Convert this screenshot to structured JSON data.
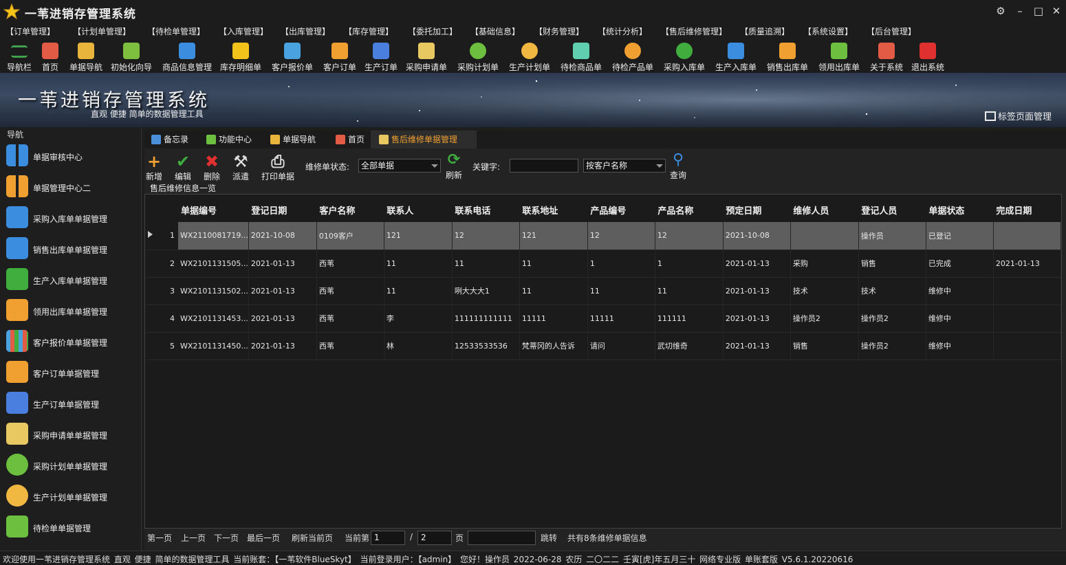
{
  "app": {
    "title": "一苇进销存管理系统"
  },
  "menu": [
    "【订单管理】",
    "【计划单管理】",
    "【待检单管理】",
    "【入库管理】",
    "【出库管理】",
    "【库存管理】",
    "【委托加工】",
    "【基础信息】",
    "【财务管理】",
    "【统计分析】",
    "【售后维修管理】",
    "【质量追溯】",
    "【系统设置】",
    "【后台管理】"
  ],
  "toolbar": [
    {
      "label": "导航栏",
      "icon": "menu-icon",
      "color": "#3fa34d"
    },
    {
      "label": "首页",
      "icon": "home-icon",
      "color": "#e25b45"
    },
    {
      "label": "单据导航",
      "icon": "pen-icon",
      "color": "#e8b43b"
    },
    {
      "label": "初始化向导",
      "icon": "wand-icon",
      "color": "#7fbf3f"
    },
    {
      "label": "商品信息管理",
      "icon": "cubes-icon",
      "color": "#3b8de0"
    },
    {
      "label": "库存明细单",
      "icon": "warning-icon",
      "color": "#f2c21a"
    },
    {
      "label": "客户报价单",
      "icon": "tag-icon",
      "color": "#4aa3df"
    },
    {
      "label": "客户订单",
      "icon": "doc-icon",
      "color": "#f0a030"
    },
    {
      "label": "生产订单",
      "icon": "doc-blue-icon",
      "color": "#4a7fe0"
    },
    {
      "label": "采购申请单",
      "icon": "request-icon",
      "color": "#e8c860"
    },
    {
      "label": "采购计划单",
      "icon": "chat-green-icon",
      "color": "#6cbf3f"
    },
    {
      "label": "生产计划单",
      "icon": "chat-yellow-icon",
      "color": "#f0b840"
    },
    {
      "label": "待检商品单",
      "icon": "flask-icon",
      "color": "#5fcfb0"
    },
    {
      "label": "待检产品单",
      "icon": "beaker-icon",
      "color": "#f0a030"
    },
    {
      "label": "采购入库单",
      "icon": "plus-circle-icon",
      "color": "#3fae3f"
    },
    {
      "label": "生产入库单",
      "icon": "trolley-icon",
      "color": "#3b8de0"
    },
    {
      "label": "销售出库单",
      "icon": "export-icon",
      "color": "#f0a030"
    },
    {
      "label": "领用出库单",
      "icon": "download-icon",
      "color": "#6cbf3f"
    },
    {
      "label": "关于系统",
      "icon": "house-icon",
      "color": "#e25b45"
    },
    {
      "label": "退出系统",
      "icon": "exit-icon",
      "color": "#e03030"
    }
  ],
  "banner": {
    "title": "一苇进销存管理系统",
    "subtitle": "直观 便捷 简单的数据管理工具",
    "tab_manager": "标签页面管理"
  },
  "sidebar": {
    "title": "导航",
    "items": [
      {
        "label": "单据审核中心",
        "icon": "grid-icon",
        "color": "#3b8de0"
      },
      {
        "label": "单据管理中心二",
        "icon": "grid-orange-icon",
        "color": "#f0a030"
      },
      {
        "label": "采购入库单单据管理",
        "icon": "arrow-left-icon",
        "color": "#3b8de0"
      },
      {
        "label": "销售出库单单据管理",
        "icon": "arrow-right-icon",
        "color": "#3b8de0"
      },
      {
        "label": "生产入库单单据管理",
        "icon": "folder-green-icon",
        "color": "#3fae3f"
      },
      {
        "label": "领用出库单单据管理",
        "icon": "house-orange-icon",
        "color": "#f0a030"
      },
      {
        "label": "客户报价单单据管理",
        "icon": "books-icon",
        "color": "#4aa3df"
      },
      {
        "label": "客户订单单据管理",
        "icon": "doc-orange-icon",
        "color": "#f0a030"
      },
      {
        "label": "生产订单单据管理",
        "icon": "doc-blue-icon",
        "color": "#4a7fe0"
      },
      {
        "label": "采购申请单单据管理",
        "icon": "mail-icon",
        "color": "#e8c860"
      },
      {
        "label": "采购计划单单据管理",
        "icon": "chat-green-icon",
        "color": "#6cbf3f"
      },
      {
        "label": "生产计划单单据管理",
        "icon": "chat-yellow-icon",
        "color": "#f0b840"
      },
      {
        "label": "待检单单据管理",
        "icon": "clipboard-icon",
        "color": "#6cbf3f"
      }
    ]
  },
  "tabs": [
    {
      "label": "备忘录",
      "icon": "memo-icon",
      "color": "#4a90d9",
      "active": false
    },
    {
      "label": "功能中心",
      "icon": "apps-icon",
      "color": "#6cbf3f",
      "active": false
    },
    {
      "label": "单据导航",
      "icon": "pen-icon",
      "color": "#e8b43b",
      "active": false
    },
    {
      "label": "首页",
      "icon": "home-icon",
      "color": "#e25b45",
      "active": false
    },
    {
      "label": "售后维修单据管理",
      "icon": "repair-icon",
      "color": "#e8c860",
      "active": true
    }
  ],
  "actions": [
    {
      "label": "新增",
      "glyph": "+",
      "color": "#f0a030"
    },
    {
      "label": "编辑",
      "glyph": "✔",
      "color": "#3fae3f"
    },
    {
      "label": "删除",
      "glyph": "✖",
      "color": "#e03030"
    },
    {
      "label": "派遣",
      "glyph": "⚒",
      "color": "#dddddd"
    },
    {
      "label": "打印单据",
      "glyph": "⎙",
      "color": "#dddddd"
    }
  ],
  "filter": {
    "status_label": "维修单状态:",
    "status_value": "全部单据",
    "refresh": "刷新",
    "keyword_label": "关键字:",
    "keyword_value": "",
    "search_by": "按客户名称",
    "query": "查询"
  },
  "group_title": "售后维修信息一览",
  "table": {
    "columns": [
      "单据编号",
      "登记日期",
      "客户名称",
      "联系人",
      "联系电话",
      "联系地址",
      "产品编号",
      "产品名称",
      "预定日期",
      "维修人员",
      "登记人员",
      "单据状态",
      "完成日期"
    ],
    "rows": [
      {
        "n": "1",
        "cells": [
          "WX2110081719...",
          "2021-10-08",
          "0109客户",
          "121",
          "12",
          "121",
          "12",
          "12",
          "2021-10-08",
          "",
          "操作员",
          "已登记",
          ""
        ]
      },
      {
        "n": "2",
        "cells": [
          "WX2101131505...",
          "2021-01-13",
          "西苇",
          "11",
          "11",
          "11",
          "1",
          "1",
          "2021-01-13",
          "采购",
          "销售",
          "已完成",
          "2021-01-13"
        ]
      },
      {
        "n": "3",
        "cells": [
          "WX2101131502...",
          "2021-01-13",
          "西苇",
          "11",
          "咧大大大1",
          "11",
          "11",
          "11",
          "2021-01-13",
          "技术",
          "技术",
          "维修中",
          ""
        ]
      },
      {
        "n": "4",
        "cells": [
          "WX2101131453...",
          "2021-01-13",
          "西苇",
          "李",
          "111111111111",
          "11111",
          "11111",
          "111111",
          "2021-01-13",
          "操作员2",
          "操作员2",
          "维修中",
          ""
        ]
      },
      {
        "n": "5",
        "cells": [
          "WX2101131450...",
          "2021-01-13",
          "西苇",
          "林",
          "12533533536",
          "梵蒂冈的人告诉",
          "请问",
          "武切维奇",
          "2021-01-13",
          "销售",
          "操作员2",
          "维修中",
          ""
        ]
      }
    ]
  },
  "pager": {
    "first": "第一页",
    "prev": "上一页",
    "next": "下一页",
    "last": "最后一页",
    "refresh": "刷新当前页",
    "current_label": "当前第",
    "current": "1",
    "sep": "/",
    "total": "2",
    "page_unit": "页",
    "jump_value": "",
    "jump": "跳转",
    "summary": "共有8条维修单据信息"
  },
  "status": "欢迎使用一苇进销存管理系统    直观 便捷 简单的数据管理工具    当前账套：【一苇软件BlueSkyt】    当前登录用户：【admin】 您好！操作员    2022-06-28  农历 二〇二二 壬寅[虎]年五月三十    网络专业版    单账套版    V5.6.1.20220616"
}
